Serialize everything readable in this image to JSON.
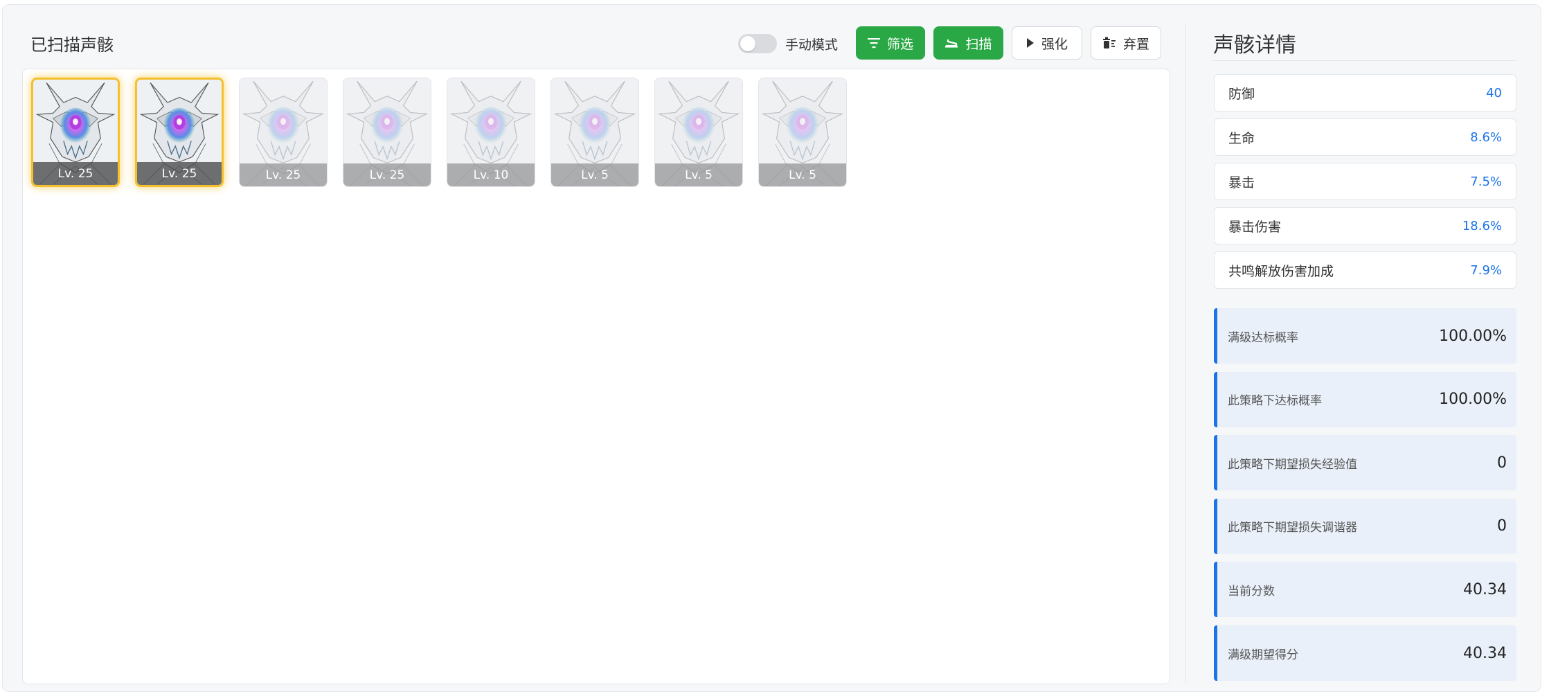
{
  "left_title": "已扫描声骸",
  "toolbar": {
    "manual_mode_label": "手动模式",
    "filter_label": "筛选",
    "scan_label": "扫描",
    "enhance_label": "强化",
    "discard_label": "弃置"
  },
  "cards": [
    {
      "level": "Lv. 25",
      "state": "selected"
    },
    {
      "level": "Lv. 25",
      "state": "selected"
    },
    {
      "level": "Lv. 25",
      "state": "dim"
    },
    {
      "level": "Lv. 25",
      "state": "dim"
    },
    {
      "level": "Lv. 10",
      "state": "dim"
    },
    {
      "level": "Lv. 5",
      "state": "dim"
    },
    {
      "level": "Lv. 5",
      "state": "dim"
    },
    {
      "level": "Lv. 5",
      "state": "dim"
    }
  ],
  "details": {
    "title": "声骸详情",
    "stats": [
      {
        "name": "防御",
        "value": "40"
      },
      {
        "name": "生命",
        "value": "8.6%"
      },
      {
        "name": "暴击",
        "value": "7.5%"
      },
      {
        "name": "暴击伤害",
        "value": "18.6%"
      },
      {
        "name": "共鸣解放伤害加成",
        "value": "7.9%"
      }
    ],
    "metrics": [
      {
        "name": "满级达标概率",
        "value": "100.00%"
      },
      {
        "name": "此策略下达标概率",
        "value": "100.00%"
      },
      {
        "name": "此策略下期望损失经验值",
        "value": "0"
      },
      {
        "name": "此策略下期望损失调谐器",
        "value": "0"
      },
      {
        "name": "当前分数",
        "value": "40.34"
      },
      {
        "name": "满级期望得分",
        "value": "40.34"
      }
    ]
  },
  "colors": {
    "accent_blue": "#1a73e8",
    "button_green": "#2aa845",
    "selected_border": "#f4c02e"
  },
  "icons": {
    "filter": "filter-icon",
    "scan": "scan-icon",
    "enhance": "play-icon",
    "discard": "trash-icon",
    "card_art": "echo-monster-icon"
  }
}
